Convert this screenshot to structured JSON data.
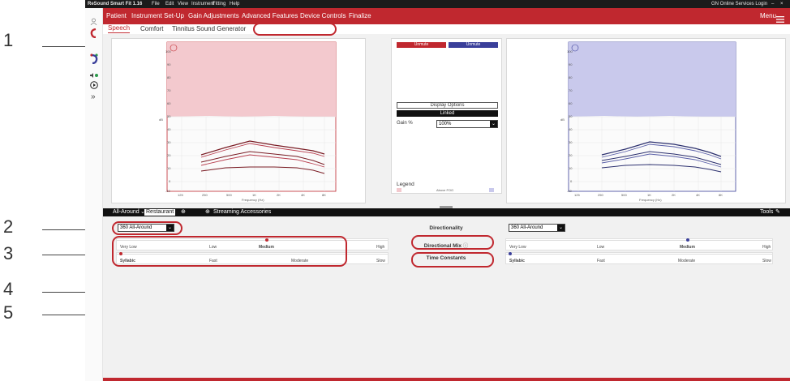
{
  "app": {
    "title": "ReSound Smart Fit 1.16",
    "menu": [
      "File",
      "Edit",
      "View",
      "Instrument",
      "Fitting",
      "Help"
    ],
    "login": "GN Online Services Login",
    "top_menu_label": "Menu"
  },
  "nav": {
    "items": [
      "Patient",
      "Instrument Set-Up",
      "Gain Adjustments",
      "Advanced Features",
      "Device Controls",
      "Finalize"
    ]
  },
  "subtabs": [
    "Speech",
    "Comfort",
    "Tinnitus Sound Generator"
  ],
  "callouts": [
    "1",
    "2",
    "3",
    "4",
    "5"
  ],
  "graph": {
    "y_ticks": [
      "100",
      "90",
      "80",
      "70",
      "60",
      "50",
      "40",
      "30",
      "20",
      "10",
      "0",
      "-10"
    ],
    "x_ticks": [
      "125",
      "250",
      "500",
      "1K",
      "2K",
      "4K",
      "8K"
    ],
    "y_unit": "dB",
    "x_label": "Frequency (Hz)"
  },
  "center": {
    "unmute_left": "Unmute",
    "unmute_right": "Unmute",
    "display_options": "Display Options",
    "linked": "Linked",
    "gain_label": "Gain %",
    "gain_value": "100%",
    "legend_title": "Legend",
    "legend_item": "Above FOG"
  },
  "programs": {
    "current": "All-Around",
    "second": "Restaurant",
    "streaming": "Streaming Accessories",
    "tools": "Tools"
  },
  "settings": {
    "left_dropdown": "360 All-Around",
    "right_dropdown": "360 All-Around",
    "directionality": "Directionality",
    "directional_mix": "Directional Mix",
    "time_constants": "Time Constants",
    "mix_levels": [
      "Very Low",
      "Low",
      "Medium",
      "High"
    ],
    "mix_selected": "Medium",
    "time_levels": [
      "Syllabic",
      "Fast",
      "Moderate",
      "Slow"
    ],
    "time_selected": "Syllabic"
  },
  "colors": {
    "accent": "#c0282f",
    "right_ear": "#3a3f9a",
    "left_fill": "#f3c9ce",
    "right_fill": "#c9c9ec"
  },
  "icons": [
    "person-icon",
    "left-ear-icon",
    "right-ear-icon",
    "speaker-icon",
    "play-icon",
    "expand-icon",
    "add-program-icon",
    "tools-icon",
    "hamburger-icon"
  ]
}
